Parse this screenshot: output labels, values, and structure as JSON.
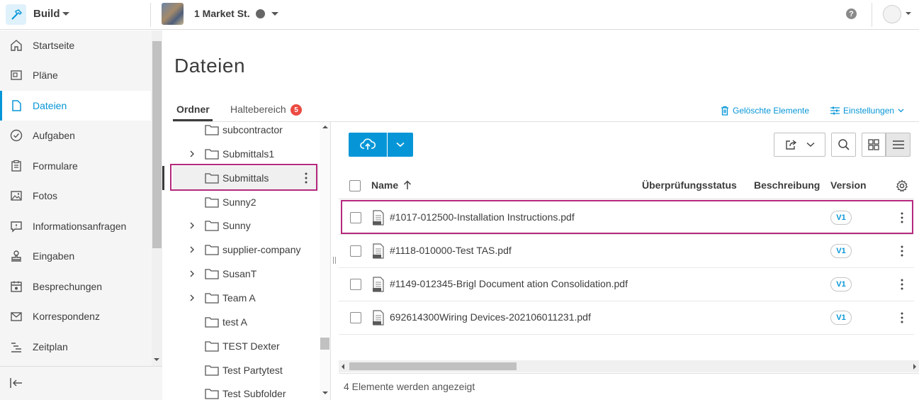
{
  "app": {
    "name": "Build"
  },
  "project": {
    "name": "1 Market St."
  },
  "sidebar": {
    "items": [
      {
        "label": "Startseite",
        "icon": "home-icon"
      },
      {
        "label": "Pläne",
        "icon": "sheets-icon"
      },
      {
        "label": "Dateien",
        "icon": "file-icon",
        "active": true
      },
      {
        "label": "Aufgaben",
        "icon": "check-circle-icon"
      },
      {
        "label": "Formulare",
        "icon": "clipboard-icon"
      },
      {
        "label": "Fotos",
        "icon": "photo-icon"
      },
      {
        "label": "Informationsanfragen",
        "icon": "chat-icon"
      },
      {
        "label": "Eingaben",
        "icon": "stamp-icon"
      },
      {
        "label": "Besprechungen",
        "icon": "calendar-icon"
      },
      {
        "label": "Korrespondenz",
        "icon": "mail-icon"
      },
      {
        "label": "Zeitplan",
        "icon": "schedule-icon"
      }
    ]
  },
  "page": {
    "title": "Dateien"
  },
  "tabs": {
    "ordner": "Ordner",
    "haltebereich": "Haltebereich",
    "haltebereich_count": "5"
  },
  "actions": {
    "deleted": "Gelöschte Elemente",
    "settings": "Einstellungen"
  },
  "folders": [
    {
      "name": "subcontractor",
      "expandable": false
    },
    {
      "name": "Submittals1",
      "expandable": true
    },
    {
      "name": "Submittals",
      "expandable": false,
      "selected": true
    },
    {
      "name": "Sunny2",
      "expandable": false
    },
    {
      "name": "Sunny",
      "expandable": true
    },
    {
      "name": "supplier-company",
      "expandable": true
    },
    {
      "name": "SusanT",
      "expandable": true
    },
    {
      "name": "Team A",
      "expandable": true
    },
    {
      "name": "test A",
      "expandable": false
    },
    {
      "name": "TEST Dexter",
      "expandable": false
    },
    {
      "name": "Test Partytest",
      "expandable": false
    },
    {
      "name": "Test Subfolder",
      "expandable": false
    }
  ],
  "table": {
    "headers": {
      "name": "Name",
      "review": "Überprüfungsstatus",
      "description": "Beschreibung",
      "version": "Version"
    },
    "rows": [
      {
        "name": "#1017-012500-Installation Instructions.pdf",
        "version": "V1"
      },
      {
        "name": "#1118-010000-Test TAS.pdf",
        "version": "V1"
      },
      {
        "name": "#1149-012345-Brigl Document ation Consolidation.pdf",
        "version": "V1"
      },
      {
        "name": "692614300Wiring Devices-202106011231.pdf",
        "version": "V1"
      }
    ]
  },
  "status": {
    "text": "4 Elemente werden angezeigt"
  },
  "colors": {
    "accent": "#0696d7",
    "highlight": "#b5297d",
    "badge": "#ec4a41"
  }
}
